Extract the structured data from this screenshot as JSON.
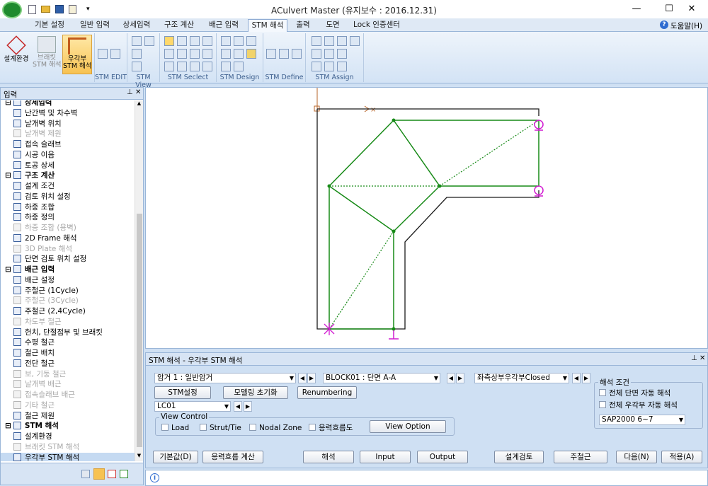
{
  "window": {
    "title": "ACulvert Master  (유지보수 : 2016.12.31)",
    "minimize_icon": "—",
    "maximize_icon": "☐",
    "close_icon": "✕"
  },
  "tabs": [
    "기본 설정",
    "일반 입력",
    "상세입력",
    "구조 계산",
    "배근 입력",
    "STM 해석",
    "출력",
    "도면",
    "Lock 인증센터"
  ],
  "help_label": "도움말(H)",
  "ribbon": {
    "big_buttons": [
      "설계환경",
      "브래킷\nSTM 해석",
      "우각부\nSTM 해석"
    ],
    "groups": [
      "STM EDIT",
      "STM View",
      "STM Seclect",
      "STM Design",
      "STM Define",
      "STM Assign"
    ]
  },
  "left_panel": {
    "title": "입력",
    "items": [
      {
        "label": "상세입력",
        "kind": "cat"
      },
      {
        "label": "난간벽 및 차수벽",
        "kind": "item"
      },
      {
        "label": "날개벽 위치",
        "kind": "item"
      },
      {
        "label": "날개벽 제원",
        "kind": "dis"
      },
      {
        "label": "접속 슬래브",
        "kind": "item"
      },
      {
        "label": "시공 이음",
        "kind": "item"
      },
      {
        "label": "토공 상세",
        "kind": "item"
      },
      {
        "label": "구조 계산",
        "kind": "cat"
      },
      {
        "label": "설계 조건",
        "kind": "item"
      },
      {
        "label": "검토 위치 설정",
        "kind": "item"
      },
      {
        "label": "하중 조합",
        "kind": "item"
      },
      {
        "label": "하중 정의",
        "kind": "item"
      },
      {
        "label": "하중 조합 (용벽)",
        "kind": "dis"
      },
      {
        "label": "2D Frame 해석",
        "kind": "item"
      },
      {
        "label": "3D Plate 해석",
        "kind": "dis"
      },
      {
        "label": "단면 검토 위치 설정",
        "kind": "item"
      },
      {
        "label": "배근 입력",
        "kind": "cat"
      },
      {
        "label": "배근 설정",
        "kind": "item"
      },
      {
        "label": "주철근 (1Cycle)",
        "kind": "item"
      },
      {
        "label": "주철근 (3Cycle)",
        "kind": "dis"
      },
      {
        "label": "주철근 (2,4Cycle)",
        "kind": "item"
      },
      {
        "label": "차도부 철근",
        "kind": "dis"
      },
      {
        "label": "헌치, 단절점부 및 브래킷",
        "kind": "item"
      },
      {
        "label": "수평 철근",
        "kind": "item"
      },
      {
        "label": "철근 배치",
        "kind": "item"
      },
      {
        "label": "전단 철근",
        "kind": "item"
      },
      {
        "label": "보, 기둥 철근",
        "kind": "dis"
      },
      {
        "label": "날개벽 배근",
        "kind": "dis"
      },
      {
        "label": "접속슬래브 배근",
        "kind": "dis"
      },
      {
        "label": "기타 철근",
        "kind": "dis"
      },
      {
        "label": "철근 제원",
        "kind": "item"
      },
      {
        "label": "STM 해석",
        "kind": "cat"
      },
      {
        "label": "설계환경",
        "kind": "item"
      },
      {
        "label": "브래킷 STM 해석",
        "kind": "dis"
      },
      {
        "label": "우각부 STM 해석",
        "kind": "sel"
      }
    ]
  },
  "stm_panel": {
    "title": "STM 해석 - 우각부 STM 해석",
    "combo_load": "암거 1 : 일반암거",
    "combo_block": "BLOCK01 : 단면 A-A",
    "combo_corner": "좌측상부우각부Closed",
    "combo_lc": "LC01",
    "btn_stm_setting": "STM설정",
    "btn_model_reset": "모델링 초기화",
    "btn_renumber": "Renumbering",
    "view_control": {
      "title": "View Control",
      "load": "Load",
      "strut": "Strut/Tie",
      "nodal": "Nodal Zone",
      "flow": "응력흐름도",
      "view_option": "View Option"
    },
    "analysis_cond": {
      "title": "해석 조건",
      "auto_section": "전체 단면 자동 해석",
      "auto_corner": "전체 우각부 자동 해석",
      "solver": "SAP2000 6~7"
    },
    "bottom_buttons": {
      "default": "기본값(D)",
      "flow_calc": "응력흐름 계산",
      "analyze": "해석",
      "input": "Input",
      "output": "Output",
      "design_check": "설계검토",
      "main_rebar": "주철근",
      "next": "다음(N)",
      "apply": "적용(A)"
    }
  },
  "colors": {
    "strut": "#178a17",
    "frame": "#1a1a1a",
    "support": "#d11bd1",
    "axis": "#b7652a"
  }
}
